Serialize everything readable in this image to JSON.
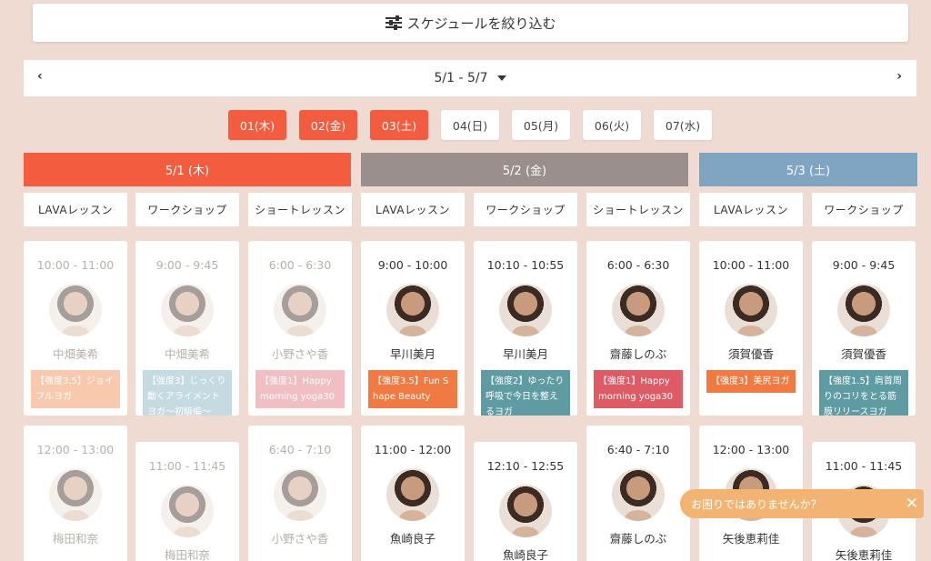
{
  "filter": {
    "label": "スケジュールを絞り込む"
  },
  "week": {
    "range": "5/1 - 5/7",
    "prev": "‹",
    "next": "›"
  },
  "days": [
    "01(木)",
    "02(金)",
    "03(土)",
    "04(日)",
    "05(月)",
    "06(火)",
    "07(水)"
  ],
  "dates": [
    {
      "label": "5/1 (木)",
      "color": "#f35c3f"
    },
    {
      "label": "5/2 (金)",
      "color": "#9b8f8d"
    },
    {
      "label": "5/3 (土)",
      "color": "#7fa5c3"
    }
  ],
  "columns": [
    "LAVAレッスン",
    "ワークショップ",
    "ショートレッスン",
    "LAVAレッスン",
    "ワークショップ",
    "ショートレッスン",
    "LAVAレッスン",
    "ワークショップ"
  ],
  "cards": [
    {
      "time": "10:00 - 11:00",
      "name": "中畑美希",
      "tag": "【強度3.5】ジョイフルヨガ",
      "tag_color": "#f08a4b"
    },
    {
      "time": "9:00 - 9:45",
      "name": "中畑美希",
      "tag": "【強度3】じっくり動くアライメントヨガ～初級編～",
      "tag_color": "#7fb0bd"
    },
    {
      "time": "6:00 - 6:30",
      "name": "小野さや香",
      "tag": "【強度1】Happy morning yoga30",
      "tag_color": "#e0707c"
    },
    {
      "time": "9:00 - 10:00",
      "name": "早川美月",
      "tag": "【強度3.5】Fun Shape Beauty",
      "tag_color": "#f07a42"
    },
    {
      "time": "10:10 - 10:55",
      "name": "早川美月",
      "tag": "【強度2】ゆったり呼吸で今日を整えるヨガ",
      "tag_color": "#5e9ba3"
    },
    {
      "time": "6:00 - 6:30",
      "name": "齋藤しのぶ",
      "tag": "【強度1】Happy morning yoga30",
      "tag_color": "#de5b66"
    },
    {
      "time": "10:00 - 11:00",
      "name": "須賀優香",
      "tag": "【強度3】美尻ヨガ",
      "tag_color": "#f07a42"
    },
    {
      "time": "9:00 - 9:45",
      "name": "須賀優香",
      "tag": "【強度1.5】肩首周りのコリをとる筋膜リリースヨガ",
      "tag_color": "#5e9ba3"
    },
    {
      "time": "12:00 - 13:00",
      "name": "梅田和奈"
    },
    {
      "time": "11:00 - 11:45",
      "name": "梅田和奈"
    },
    {
      "time": "6:40 - 7:10",
      "name": "小野さや香"
    },
    {
      "time": "11:00 - 12:00",
      "name": "魚崎良子"
    },
    {
      "time": "12:10 - 12:55",
      "name": "魚崎良子"
    },
    {
      "time": "6:40 - 7:10",
      "name": "齋藤しのぶ"
    },
    {
      "time": "12:00 - 13:00",
      "name": "矢後恵莉佳"
    },
    {
      "time": "11:00 - 11:45",
      "name": "矢後恵莉佳"
    }
  ],
  "help": {
    "text": "お困りではありませんか？",
    "close": "✕"
  }
}
